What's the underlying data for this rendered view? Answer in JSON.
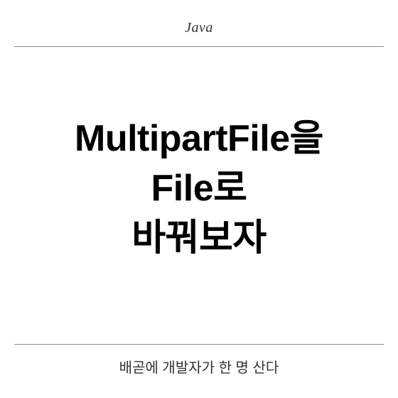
{
  "header": {
    "category": "Java"
  },
  "main": {
    "title_line_1": "MultipartFile을",
    "title_line_2": "File로",
    "title_line_3": "바꿔보자"
  },
  "footer": {
    "subtitle": "배곧에 개발자가 한 명 산다"
  }
}
